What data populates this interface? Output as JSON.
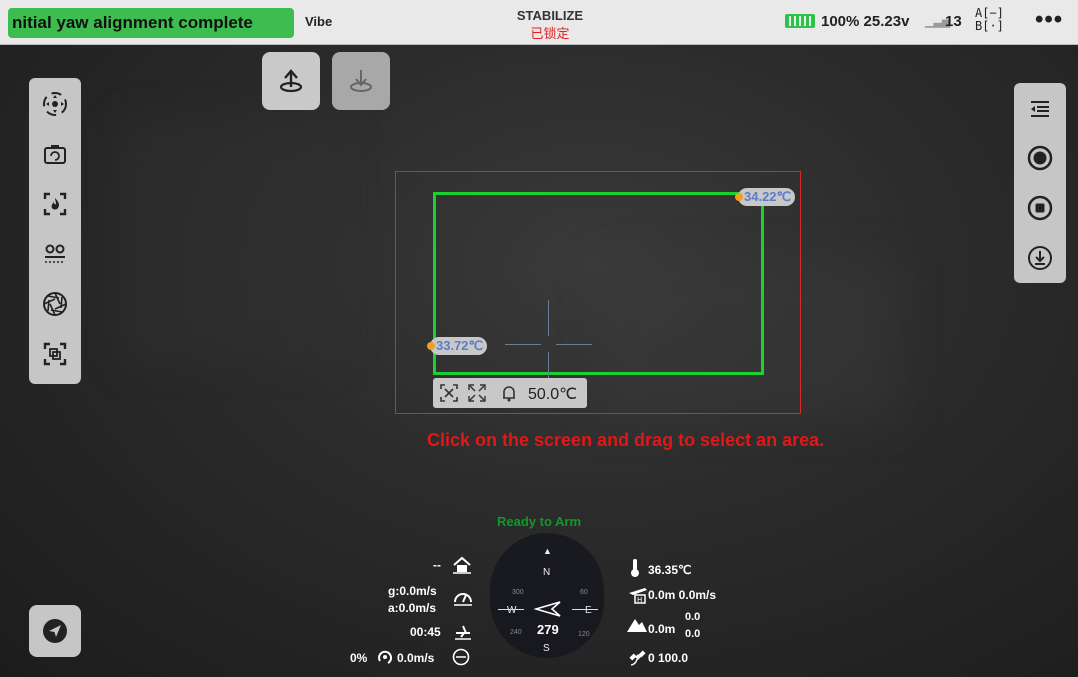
{
  "topbar": {
    "status_message": "nitial yaw alignment complete",
    "vibe_label": "Vibe",
    "flight_mode": "STABILIZE",
    "arm_state": "已锁定",
    "battery_text": "100% 25.23v",
    "signal_count": "13",
    "ab_label": "A[−]\nB[·]",
    "more_label": "•••"
  },
  "selection": {
    "max_temp": "34.22℃",
    "min_temp": "33.72℃",
    "alarm_temp": "50.0℃"
  },
  "instruction": "Click on the screen and drag to select an area.",
  "ready_text": "Ready to Arm",
  "telemetry": {
    "home_dist": "--",
    "ground_speed": "g:0.0m/s",
    "air_speed": "a:0.0m/s",
    "flight_time": "00:45",
    "throttle_climb": "0% ",
    "climb_rate": "0.0m/s",
    "temperature": "36.35℃",
    "alt_speed": "0.0m 0.0m/s",
    "altitude": "0.0m",
    "alt_sup": "0.0",
    "alt_sub": "0.0",
    "gps": "0 100.0"
  },
  "compass": {
    "n": "N",
    "s": "S",
    "e": "E",
    "w": "W",
    "t300": "300",
    "t60": "60",
    "t120": "120",
    "t240": "240",
    "heading": "279"
  },
  "colors": {
    "status_green": "#3dbd4f",
    "alert_red": "#e01818",
    "selection_green": "#19d230",
    "selection_red": "#d82828",
    "ready_green": "#0e9a2a"
  }
}
